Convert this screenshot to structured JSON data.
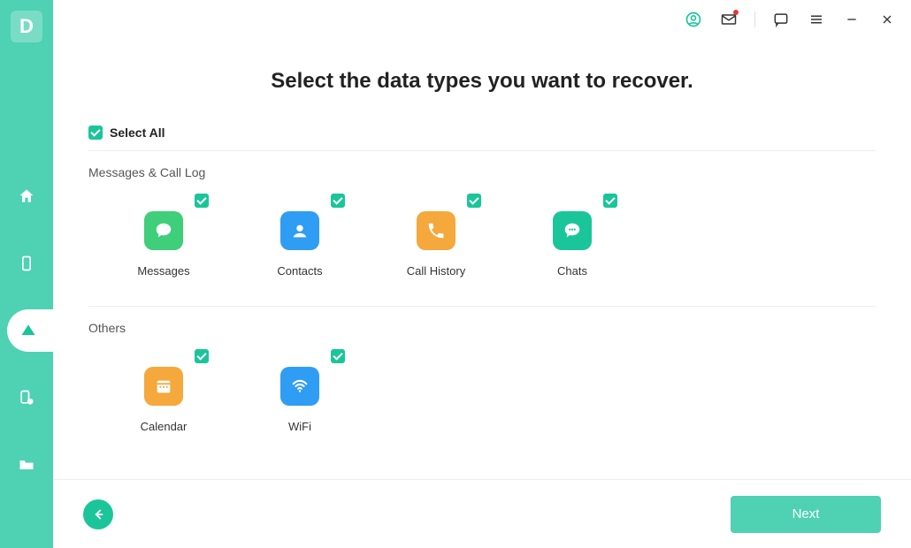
{
  "app": {
    "brand_letter": "D"
  },
  "header": {
    "icons": [
      "account",
      "mail",
      "feedback",
      "menu",
      "minimize",
      "close"
    ],
    "mail_has_notification": true
  },
  "page": {
    "title": "Select the data types you want to recover.",
    "select_all_label": "Select All"
  },
  "sections": [
    {
      "label": "Messages & Call Log",
      "items": [
        {
          "key": "messages",
          "label": "Messages",
          "checked": true,
          "color": "green",
          "icon": "speech-bubble"
        },
        {
          "key": "contacts",
          "label": "Contacts",
          "checked": true,
          "color": "blue",
          "icon": "person"
        },
        {
          "key": "call_history",
          "label": "Call History",
          "checked": true,
          "color": "orange",
          "icon": "phone"
        },
        {
          "key": "chats",
          "label": "Chats",
          "checked": true,
          "color": "teal",
          "icon": "chat-dots"
        }
      ]
    },
    {
      "label": "Others",
      "items": [
        {
          "key": "calendar",
          "label": "Calendar",
          "checked": true,
          "color": "orange",
          "icon": "calendar"
        },
        {
          "key": "wifi",
          "label": "WiFi",
          "checked": true,
          "color": "blue",
          "icon": "wifi"
        }
      ]
    }
  ],
  "footer": {
    "next_label": "Next"
  },
  "sidebar": {
    "items": [
      {
        "key": "home",
        "active": false
      },
      {
        "key": "phone",
        "active": false
      },
      {
        "key": "cloud",
        "active": true
      },
      {
        "key": "device-alert",
        "active": false
      },
      {
        "key": "folder",
        "active": false
      }
    ]
  },
  "colors": {
    "accent": "#4fd1b3",
    "accent_dark": "#1bc59a",
    "tile_green": "#3fce7a",
    "tile_blue": "#2f9df4",
    "tile_orange": "#f5a83b",
    "tile_teal": "#1bc59a"
  }
}
